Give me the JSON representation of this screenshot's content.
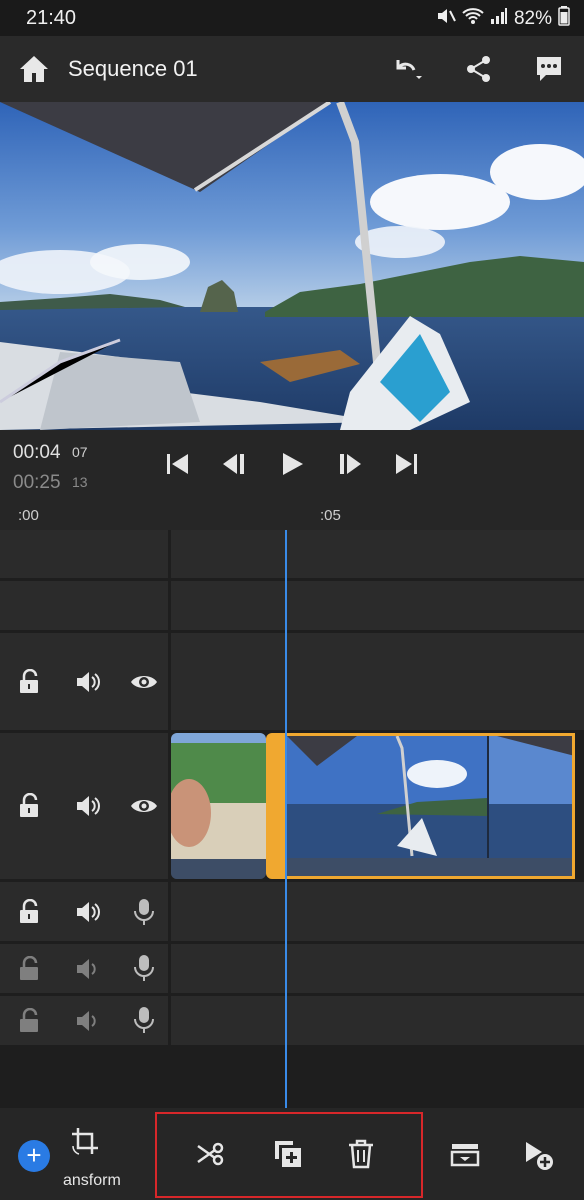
{
  "status": {
    "time": "21:40",
    "battery": "82%"
  },
  "appbar": {
    "title": "Sequence 01"
  },
  "transport": {
    "current_time": "00:04",
    "current_frames": "07",
    "duration_time": "00:25",
    "duration_frames": "13"
  },
  "ruler": {
    "start_label": ":00",
    "mark_label": ":05"
  },
  "bottom": {
    "transform_label": "ansform"
  },
  "colors": {
    "accent": "#2a7be4",
    "playhead": "#3a8be8",
    "clip_selected": "#f0a830",
    "highlight": "#d8272a"
  },
  "icons": [
    "home-icon",
    "undo-icon",
    "share-icon",
    "comment-icon",
    "go-to-start-icon",
    "step-back-icon",
    "play-icon",
    "step-forward-icon",
    "go-to-end-icon",
    "lock-icon",
    "speaker-icon",
    "eye-icon",
    "microphone-icon",
    "add-icon",
    "crop-rotate-icon",
    "scissors-icon",
    "duplicate-icon",
    "trash-icon",
    "export-tray-icon",
    "add-to-timeline-icon"
  ]
}
